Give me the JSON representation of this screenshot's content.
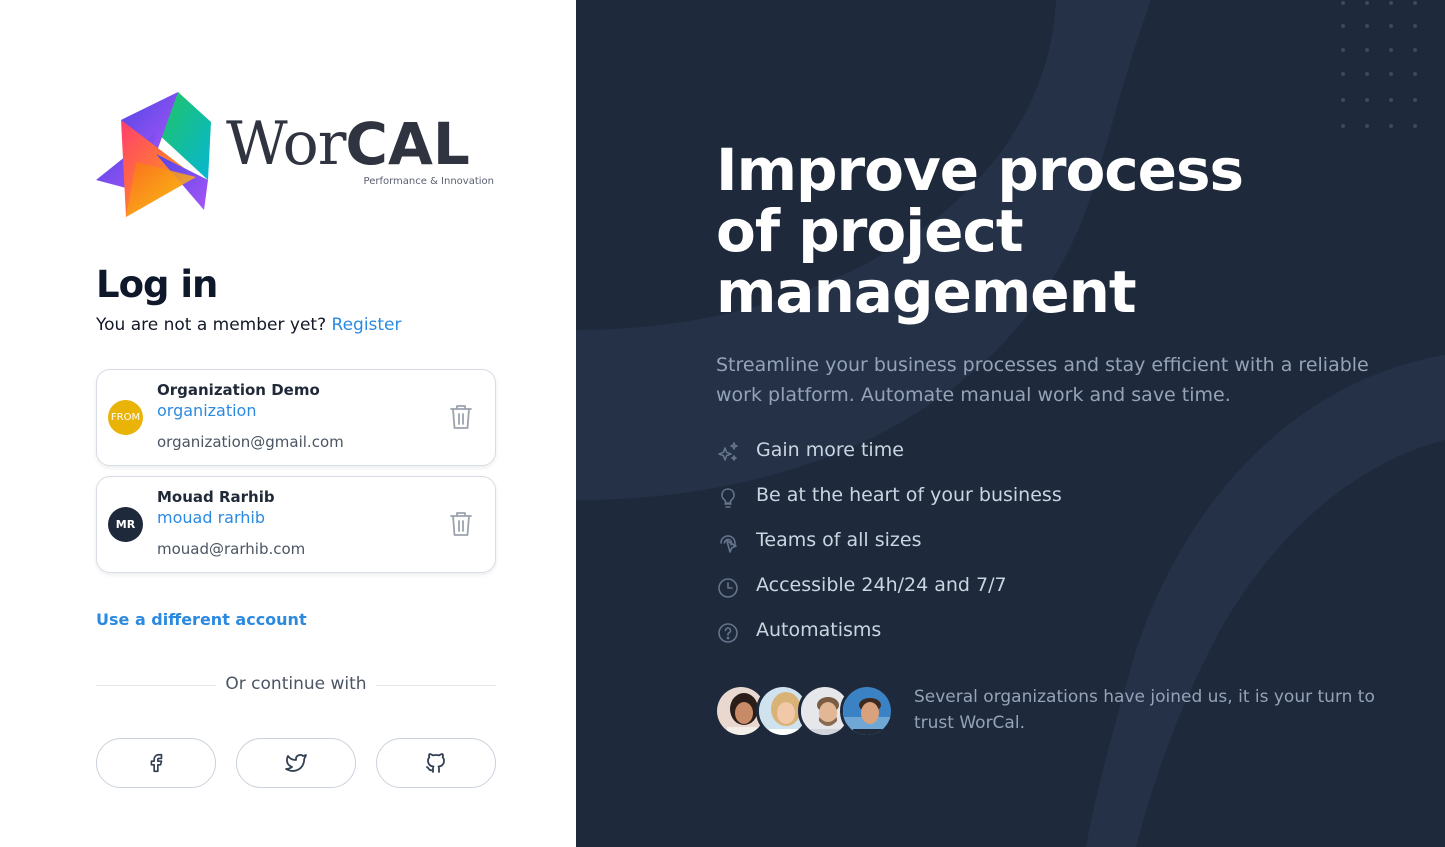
{
  "brand": {
    "word_part1": "Wor",
    "word_part2": "CAL",
    "tagline": "Performance & Innovation"
  },
  "login": {
    "title": "Log in",
    "member_prompt": "You are not a member yet?",
    "register_link": "Register"
  },
  "accounts": [
    {
      "avatar_text": "FROM",
      "avatar_color": "#eab308",
      "name": "Organization Demo",
      "organization": "organization",
      "email": "organization@gmail.com"
    },
    {
      "avatar_text": "MR",
      "avatar_color": "#1e293b",
      "name": "Mouad Rarhib",
      "organization": "mouad rarhib",
      "email": "mouad@rarhib.com"
    }
  ],
  "use_different_account": "Use a different account",
  "continue_with": "Or continue with",
  "social_buttons": [
    {
      "icon": "facebook-icon"
    },
    {
      "icon": "twitter-icon"
    },
    {
      "icon": "github-icon"
    }
  ],
  "hero": {
    "headline_lines": [
      "Improve process",
      "of project",
      "management"
    ],
    "subtitle": "Streamline your business processes and stay efficient with a reliable work platform. Automate manual work and save time.",
    "features": [
      {
        "icon": "sparkles-icon",
        "label": "Gain more time"
      },
      {
        "icon": "lightbulb-icon",
        "label": "Be at the heart of your business"
      },
      {
        "icon": "pointer-icon",
        "label": "Teams of all sizes"
      },
      {
        "icon": "clock-icon",
        "label": "Accessible 24h/24 and 7/7"
      },
      {
        "icon": "question-icon",
        "label": "Automatisms"
      }
    ],
    "trust_text": "Several organizations have joined us, it is your turn to trust WorCal."
  },
  "colors": {
    "accent": "#2b8ae0",
    "dark_panel": "#1e293b",
    "muted_text": "#94a3b8"
  }
}
